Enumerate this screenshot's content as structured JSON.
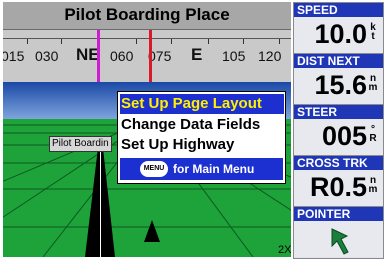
{
  "header": {
    "title": "Pilot Boarding Place"
  },
  "compass": {
    "labels": [
      "015",
      "030",
      "NE",
      "060",
      "075",
      "E",
      "105",
      "120"
    ]
  },
  "map": {
    "waypoint_label": "Pilot Boardin",
    "zoom": "2X"
  },
  "menu": {
    "items": [
      "Set Up Page Layout",
      "Change Data Fields",
      "Set Up Highway"
    ],
    "selected_index": 0,
    "footer_button": "MENU",
    "footer_text": "for Main Menu"
  },
  "fields": [
    {
      "label": "SPEED",
      "value": "10.0",
      "unit_top": "k",
      "unit_bottom": "t"
    },
    {
      "label": "DIST NEXT",
      "value": "15.6",
      "unit_top": "n",
      "unit_bottom": "m"
    },
    {
      "label": "STEER",
      "value": "005",
      "unit_top": "°",
      "unit_bottom": "R"
    },
    {
      "label": "CROSS TRK",
      "value": "R0.5",
      "unit_top": "n",
      "unit_bottom": "m"
    },
    {
      "label": "POINTER",
      "icon": "pointer-arrow-icon"
    }
  ],
  "colors": {
    "menu_highlight": "#1e2fd0",
    "menu_highlight_text": "#fff000",
    "field_header": "#1f36b7",
    "ground": "#1ea23a",
    "bearing_marker": "#d21ad2",
    "course_marker": "#d8192c",
    "pointer": "#1a7f3c"
  }
}
